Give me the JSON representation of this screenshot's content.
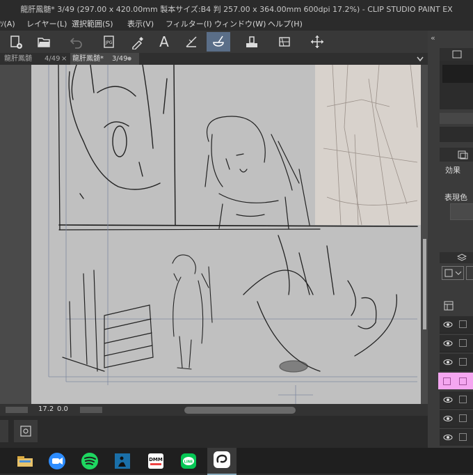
{
  "window": {
    "title": "龍肝鳳髄* 3/49 (297.00 x 420.00mm 製本サイズ:B4 判 257.00 x 364.00mm 600dpi 17.2%)  - CLIP STUDIO PAINT EX"
  },
  "menu": {
    "items": [
      "ｿ(A)",
      "レイヤー(L)",
      "選択範囲(S)",
      "表示(V)",
      "フィルター(I)",
      "ウィンドウ(W)",
      "ヘルプ(H)"
    ]
  },
  "toolbar": {
    "icons": [
      "new-file-icon",
      "open-folder-icon",
      "undo-icon",
      "export-jpeg-icon",
      "eyedropper-icon",
      "text-tool-icon",
      "ruler-icon",
      "fill-bucket-icon",
      "stamp-icon",
      "layer-transform-icon",
      "move-icon"
    ],
    "active": "fill-bucket-icon",
    "jpeg_label": "JPG",
    "text_glyph": "A"
  },
  "tabs": [
    {
      "name": "龍肝鳳髄",
      "page": "4/49",
      "close": "×"
    },
    {
      "name": "龍肝鳳髄*",
      "page": "3/49",
      "close": "●"
    }
  ],
  "panel": {
    "effect_label": "効果",
    "expression_color_label": "表現色",
    "collapse_glyph": "«"
  },
  "status": {
    "zoom": "17.2",
    "rotation": "0.0"
  },
  "taskbar": {
    "apps": [
      "explorer",
      "zoom",
      "spotify",
      "kindle",
      "dmm-books",
      "line",
      "clip-studio"
    ],
    "dmm_label": "DMM",
    "line_label": "LINE"
  },
  "colors": {
    "active_tool": "#5a6e88",
    "selected_layer": "#f4a6f0",
    "paper": "#c0c0c0",
    "accent_blue": "#2b7fd6"
  }
}
